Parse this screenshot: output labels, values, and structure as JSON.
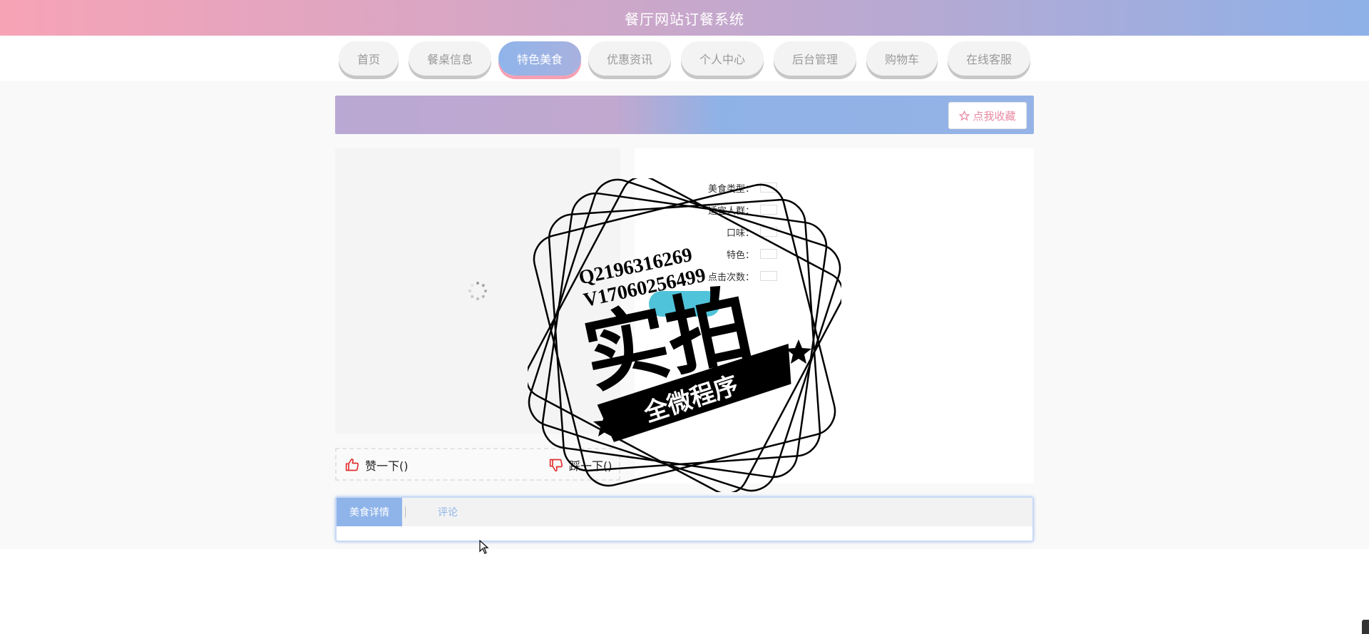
{
  "header": {
    "title": "餐厅网站订餐系统"
  },
  "nav": {
    "items": [
      {
        "label": "首页"
      },
      {
        "label": "餐桌信息"
      },
      {
        "label": "特色美食"
      },
      {
        "label": "优惠资讯"
      },
      {
        "label": "个人中心"
      },
      {
        "label": "后台管理"
      },
      {
        "label": "购物车"
      },
      {
        "label": "在线客服"
      }
    ],
    "active_index": 2
  },
  "banner": {
    "fav_label": "点我收藏",
    "fav_icon": "star-outline-icon"
  },
  "votes": {
    "up_label": "赞一下()",
    "down_label": "踩一下()",
    "up_icon": "thumbs-up-icon",
    "down_icon": "thumbs-down-icon"
  },
  "detail": {
    "fields": [
      {
        "label": "美食类型："
      },
      {
        "label": "适宜人群："
      },
      {
        "label": "口味："
      },
      {
        "label": "特色："
      },
      {
        "label": "点击次数："
      }
    ]
  },
  "tabs": [
    {
      "label": "美食详情"
    },
    {
      "label": "评论"
    }
  ],
  "watermark": {
    "line1": "Q2196316269",
    "line2": "V17060256499",
    "main": "实拍",
    "ribbon": "全微程序"
  },
  "colors": {
    "accent_blue": "#8fb4ea",
    "accent_pink": "#f5a0b4",
    "thumb_red": "#e0302f",
    "fav_pink": "#e88aa3"
  }
}
